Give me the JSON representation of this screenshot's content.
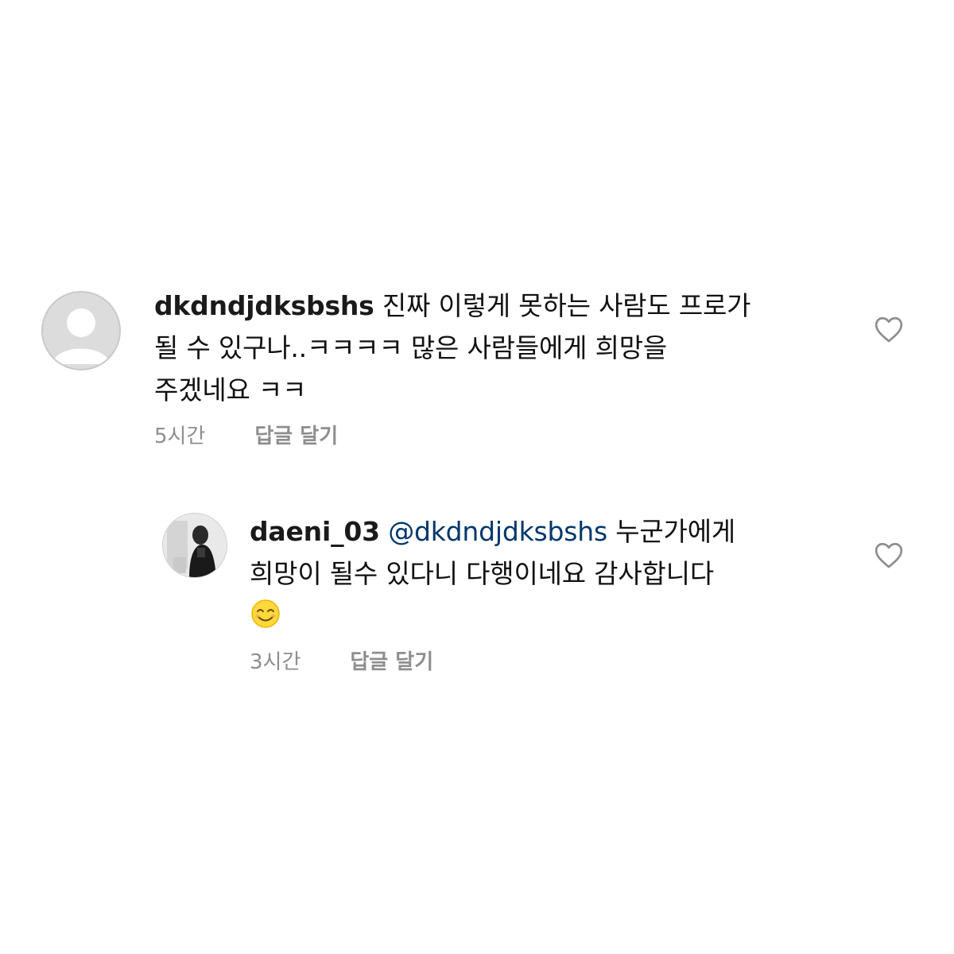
{
  "comments": [
    {
      "username": "dkdndjdksbshs",
      "text": " 진짜 이렇게 못하는 사람도 프로가\n될 수 있구나..ㅋㅋㅋㅋ 많은 사람들에게 희망을\n주겠네요 ㅋㅋ",
      "time": "5시간",
      "reply_label": "답글 달기",
      "avatar": "default-avatar-icon",
      "like_icon": "heart-outline-icon"
    },
    {
      "username": "daeni_03",
      "mention": "@dkdndjdksbshs",
      "text": " 누군가에게\n희망이 될수 있다니 다행이네요 감사합니다\n",
      "emoji": "smiling-face-emoji",
      "time": "3시간",
      "reply_label": "답글 달기",
      "avatar": "photo-avatar",
      "like_icon": "heart-outline-icon"
    }
  ],
  "colors": {
    "text": "#111111",
    "meta": "#8e8e8e",
    "mention": "#00376b",
    "icon": "#8e8e8e"
  }
}
